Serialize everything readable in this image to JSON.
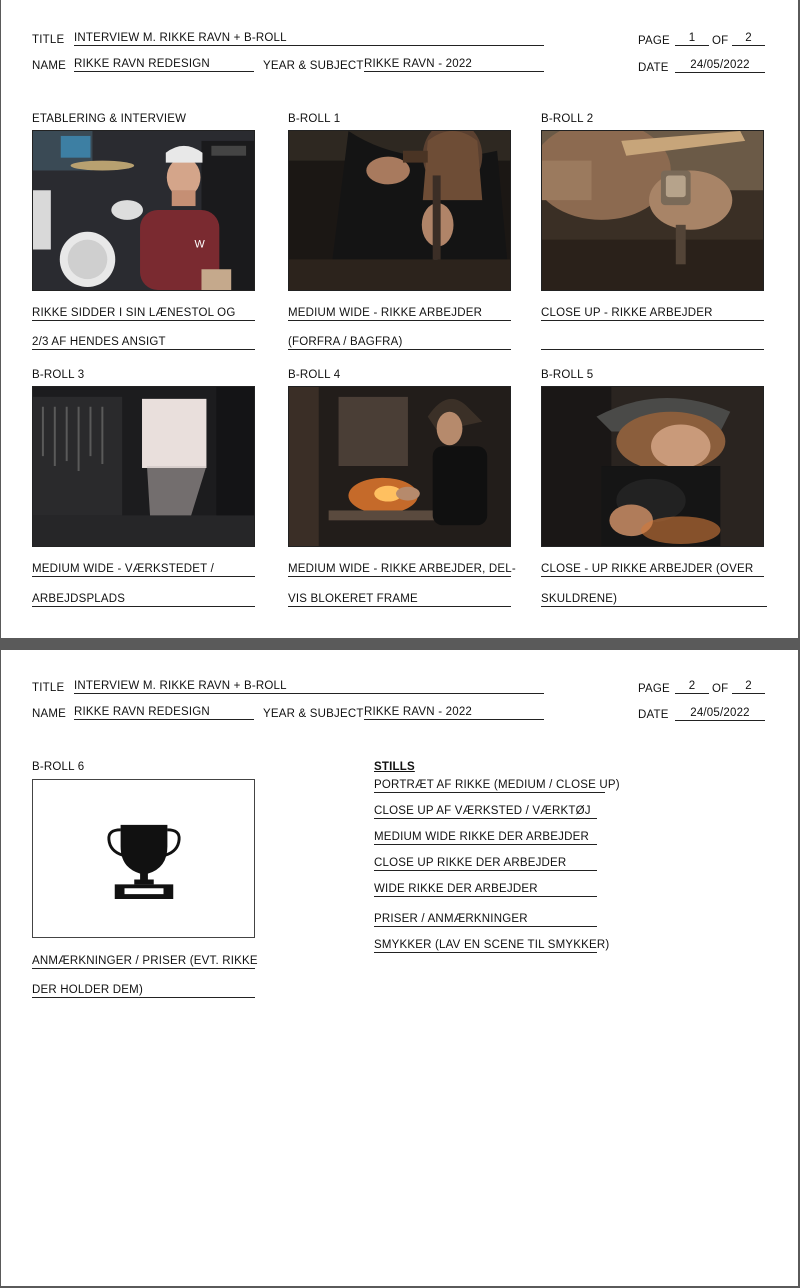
{
  "pages": [
    {
      "header": {
        "title_label": "TITLE",
        "title_value": "INTERVIEW M. RIKKE RAVN + B-ROLL",
        "name_label": "NAME",
        "name_value": "RIKKE RAVN REDESIGN",
        "year_label": "YEAR & SUBJECT",
        "year_value": "RIKKE RAVN - 2022",
        "page_label": "PAGE",
        "page_num": "1",
        "of_label": "OF",
        "page_total": "2",
        "date_label": "DATE",
        "date_value": "24/05/2022"
      },
      "shots": [
        {
          "label": "ETABLERING & INTERVIEW",
          "line1": "RIKKE SIDDER I SIN LÆNESTOL OG",
          "line2": "2/3 AF HENDES ANSIGT"
        },
        {
          "label": "B-ROLL 1",
          "line1": "MEDIUM WIDE - RIKKE ARBEJDER",
          "line2": "(FORFRA / BAGFRA)"
        },
        {
          "label": "B-ROLL 2",
          "line1": "CLOSE UP - RIKKE ARBEJDER",
          "line2": ""
        },
        {
          "label": "B-ROLL 3",
          "line1": "MEDIUM WIDE - VÆRKSTEDET /",
          "line2": "ARBEJDSPLADS"
        },
        {
          "label": "B-ROLL 4",
          "line1": "MEDIUM WIDE - RIKKE ARBEJDER, DEL-",
          "line2": "VIS BLOKERET FRAME"
        },
        {
          "label": "B-ROLL 5",
          "line1": "CLOSE - UP RIKKE ARBEJDER (OVER",
          "line2": "SKULDRENE)"
        }
      ]
    },
    {
      "header": {
        "title_label": "TITLE",
        "title_value": "INTERVIEW M. RIKKE RAVN + B-ROLL",
        "name_label": "NAME",
        "name_value": "RIKKE RAVN REDESIGN",
        "year_label": "YEAR & SUBJECT",
        "year_value": "RIKKE RAVN - 2022",
        "page_label": "PAGE",
        "page_num": "2",
        "of_label": "OF",
        "page_total": "2",
        "date_label": "DATE",
        "date_value": "24/05/2022"
      },
      "shot": {
        "label": "B-ROLL 6",
        "line1": "ANMÆRKNINGER / PRISER (EVT. RIKKE",
        "line2": "DER HOLDER DEM)",
        "icon": "trophy-icon"
      },
      "stills": {
        "heading": "STILLS",
        "items": [
          "PORTRÆT AF RIKKE (MEDIUM / CLOSE UP)",
          "CLOSE UP AF VÆRKSTED / VÆRKTØJ",
          "MEDIUM WIDE RIKKE DER ARBEJDER",
          "CLOSE UP RIKKE DER ARBEJDER",
          "WIDE RIKKE DER ARBEJDER",
          "PRISER / ANMÆRKNINGER",
          "SMYKKER (LAV EN SCENE TIL SMYKKER)"
        ]
      }
    }
  ]
}
